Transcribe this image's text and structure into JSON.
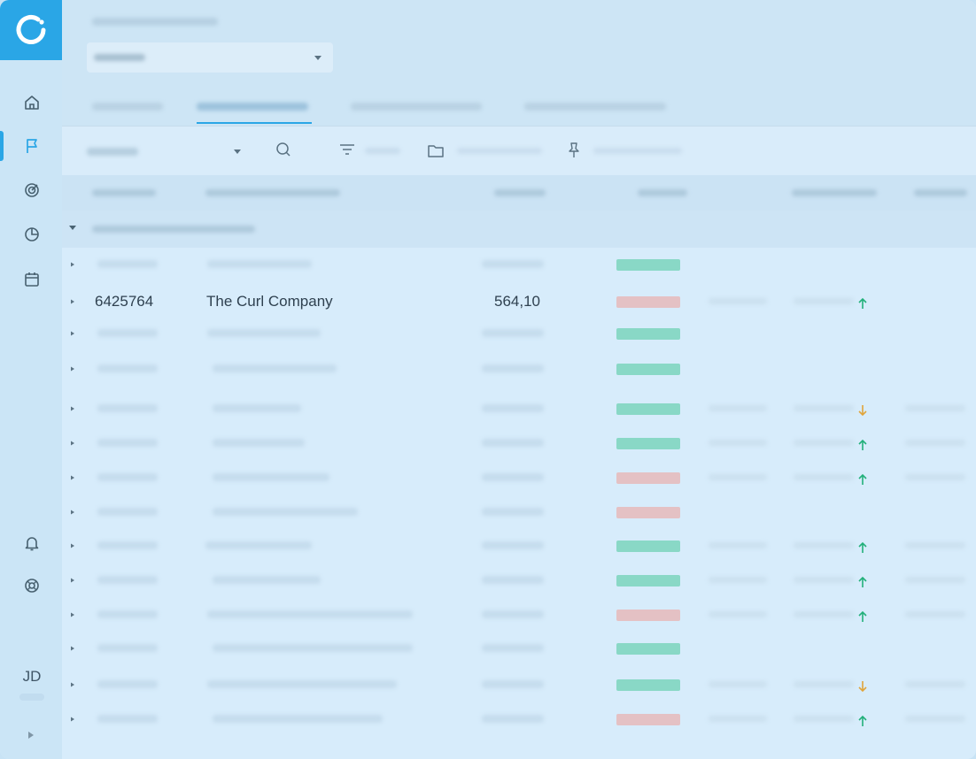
{
  "user": {
    "initials": "JD"
  },
  "sidebar": {
    "items": [
      {
        "icon": "home-icon"
      },
      {
        "icon": "flag-icon",
        "active": true
      },
      {
        "icon": "target-icon"
      },
      {
        "icon": "pie-chart-icon"
      },
      {
        "icon": "calendar-icon"
      }
    ],
    "bottom_items": [
      {
        "icon": "bell-icon"
      },
      {
        "icon": "lifebuoy-icon"
      }
    ]
  },
  "table": {
    "visible_row": {
      "id": "6425764",
      "name": "The Curl Company",
      "amount": "564,10"
    },
    "row_statuses": [
      "green",
      "red",
      "green",
      "green",
      "green",
      "green",
      "red",
      "red",
      "green",
      "green",
      "red",
      "green",
      "green",
      "red"
    ],
    "row_trends": [
      "none",
      "up",
      "none",
      "none",
      "down",
      "up",
      "up",
      "none",
      "up",
      "up",
      "up",
      "none",
      "down",
      "up"
    ]
  },
  "colors": {
    "accent": "#2aa6e6",
    "status_green": "#89d8c6",
    "status_red": "#e4c1c4",
    "trend_up": "#23b07a",
    "trend_down": "#e0a43a"
  }
}
